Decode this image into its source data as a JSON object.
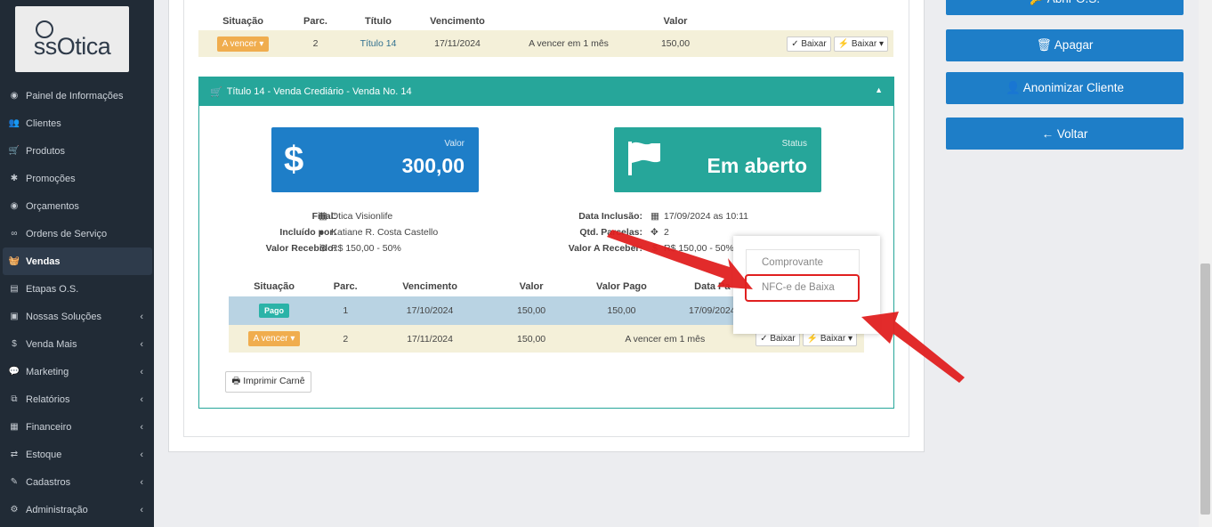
{
  "sidebar": {
    "logo_text": "ssOtica",
    "items": [
      {
        "label": "Painel de Informações",
        "icon": "dashboard-icon",
        "glyph": "◉"
      },
      {
        "label": "Clientes",
        "icon": "users-icon",
        "glyph": "👥"
      },
      {
        "label": "Produtos",
        "icon": "cart-icon",
        "glyph": "🛒"
      },
      {
        "label": "Promoções",
        "icon": "asterisk-icon",
        "glyph": "✱"
      },
      {
        "label": "Orçamentos",
        "icon": "calculator-icon",
        "glyph": "◉"
      },
      {
        "label": "Ordens de Serviço",
        "icon": "glasses-icon",
        "glyph": "∞"
      },
      {
        "label": "Vendas",
        "icon": "basket-icon",
        "glyph": "🧺"
      },
      {
        "label": "Etapas O.S.",
        "icon": "list-icon",
        "glyph": "▤"
      },
      {
        "label": "Nossas Soluções",
        "icon": "briefcase-icon",
        "glyph": "▣"
      },
      {
        "label": "Venda Mais",
        "icon": "dollar-icon",
        "glyph": "$"
      },
      {
        "label": "Marketing",
        "icon": "comments-icon",
        "glyph": "💬"
      },
      {
        "label": "Relatórios",
        "icon": "copy-icon",
        "glyph": "⧉"
      },
      {
        "label": "Financeiro",
        "icon": "money-icon",
        "glyph": "▦"
      },
      {
        "label": "Estoque",
        "icon": "exchange-icon",
        "glyph": "⇄"
      },
      {
        "label": "Cadastros",
        "icon": "edit-icon",
        "glyph": "✎"
      },
      {
        "label": "Administração",
        "icon": "cogs-icon",
        "glyph": "⚙"
      }
    ]
  },
  "top_table": {
    "headers": [
      "Situação",
      "Parc.",
      "Título",
      "Vencimento",
      "",
      "Valor",
      ""
    ],
    "row": {
      "situacao": "A vencer ▾",
      "parc": "2",
      "titulo": "Título 14",
      "vencimento": "17/11/2024",
      "descricao": "A vencer em 1 mês",
      "valor": "150,00",
      "baixar": "✓ Baixar",
      "baixar_dropdown": "⚡ Baixar ▾"
    }
  },
  "panel": {
    "title": "Título 14 - Venda Crediário - Venda No. 14",
    "valor_card": {
      "label": "Valor",
      "value": "300,00",
      "icon": "$"
    },
    "status_card": {
      "label": "Status",
      "value": "Em aberto"
    },
    "info_left": [
      {
        "label": "Filial:",
        "value": "Otica Visionlife",
        "icon": "building-icon",
        "glyph": "▦"
      },
      {
        "label": "Incluído por:",
        "value": "Katiane R. Costa Castello",
        "icon": "user-icon",
        "glyph": "●"
      },
      {
        "label": "Valor Recebido:",
        "value": "R$ 150,00 - 50%",
        "icon": "dollar-icon",
        "glyph": "$"
      }
    ],
    "info_right": [
      {
        "label": "Data Inclusão:",
        "value": "17/09/2024 as 10:11",
        "icon": "calendar-icon",
        "glyph": "▦"
      },
      {
        "label": "Qtd. Parcelas:",
        "value": "2",
        "icon": "puzzle-icon",
        "glyph": "✥"
      },
      {
        "label": "Valor A Receber:",
        "value": "R$ 150,00 - 50%",
        "icon": "dollar-icon",
        "glyph": "$"
      }
    ],
    "inner_table": {
      "headers": [
        "Situação",
        "Parc.",
        "Vencimento",
        "Valor",
        "Valor Pago",
        "Data Pa",
        ""
      ],
      "rows": [
        {
          "situacao": "Pago",
          "parc": "1",
          "vencimento": "17/10/2024",
          "valor": "150,00",
          "valor_pago": "150,00",
          "data": "17/09/2024"
        },
        {
          "situacao": "A vencer ▾",
          "parc": "2",
          "vencimento": "17/11/2024",
          "valor": "150,00",
          "valor_pago": "A vencer em 1 mês",
          "data": "",
          "baixar": "✓ Baixar",
          "baixar_dropdown": "⚡ Baixar ▾"
        }
      ]
    },
    "print_carne": "🖶 Imprimir Carnê"
  },
  "dropdown_menu": {
    "items": [
      "Comprovante",
      "NFC-e de Baixa"
    ]
  },
  "right_actions": {
    "abrir_os": "🔑 Abrir O.S.",
    "apagar": "🗑 Apagar",
    "anonimizar": "👤 Anonimizar Cliente",
    "voltar": "← Voltar"
  },
  "colors": {
    "sidebar_bg": "#212b36",
    "primary": "#1e7ec8",
    "teal": "#26a69a",
    "warning": "#f0ad4e",
    "annotation_red": "#e02020"
  }
}
